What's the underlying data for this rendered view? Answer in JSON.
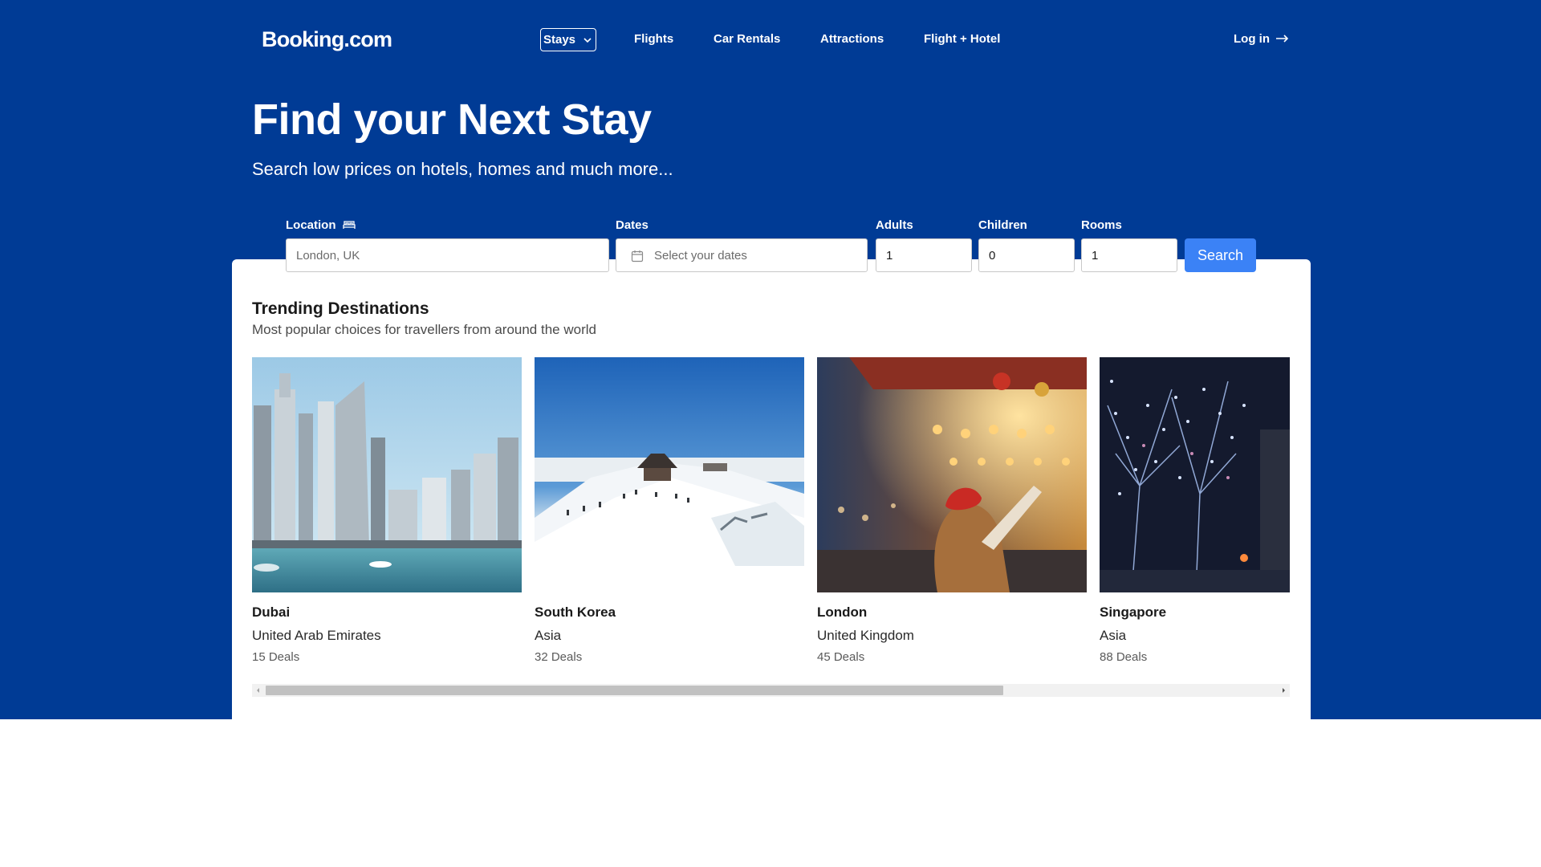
{
  "brand": {
    "logo": "Booking.com",
    "primary_color": "#003b95",
    "accent_color": "#3b82f6"
  },
  "nav": {
    "items": [
      {
        "label": "Stays",
        "active": true,
        "icon": "chevron-down-icon"
      },
      {
        "label": "Flights"
      },
      {
        "label": "Car Rentals"
      },
      {
        "label": "Attractions"
      },
      {
        "label": "Flight + Hotel"
      }
    ],
    "login_label": "Log in",
    "login_icon": "arrow-right-icon"
  },
  "hero": {
    "title": "Find your Next Stay",
    "subtitle": "Search low prices on hotels, homes and much more..."
  },
  "search": {
    "location_label": "Location",
    "location_icon": "bed-icon",
    "location_placeholder": "London, UK",
    "dates_label": "Dates",
    "dates_icon": "calendar-icon",
    "dates_placeholder": "Select your dates",
    "adults_label": "Adults",
    "adults_value": "1",
    "children_label": "Children",
    "children_value": "0",
    "rooms_label": "Rooms",
    "rooms_value": "1",
    "submit_label": "Search"
  },
  "trending": {
    "title": "Trending Destinations",
    "subtitle": "Most popular choices for travellers from around the world",
    "destinations": [
      {
        "city": "Dubai",
        "region": "United Arab Emirates",
        "deals": "15 Deals"
      },
      {
        "city": "South Korea",
        "region": "Asia",
        "deals": "32 Deals"
      },
      {
        "city": "London",
        "region": "United Kingdom",
        "deals": "45 Deals"
      },
      {
        "city": "Singapore",
        "region": "Asia",
        "deals": "88 Deals"
      }
    ],
    "scroll_fraction_visible": 0.73
  }
}
